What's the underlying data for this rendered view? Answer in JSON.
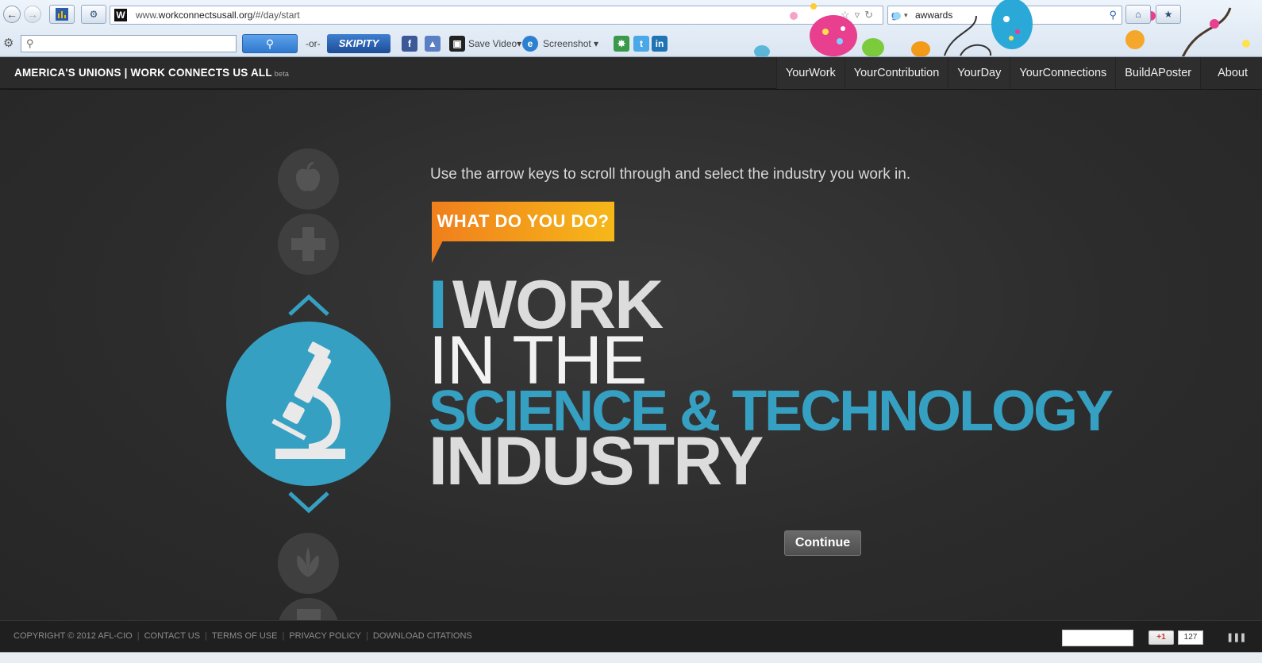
{
  "browser": {
    "url_prefix": "www.",
    "url_host": "workconnectsusall.org",
    "url_path": "/#/day/start",
    "search_query": "awwards",
    "toolbar": {
      "or_label": "-or-",
      "skipity_label": "SKIPITY",
      "save_video_label": "Save Video",
      "screenshot_label": "Screenshot"
    }
  },
  "site": {
    "brand": "AMERICA'S UNIONS | WORK CONNECTS US ALL",
    "beta": "beta",
    "nav": [
      "YourWork",
      "YourContribution",
      "YourDay",
      "YourConnections",
      "BuildAPoster",
      "About"
    ]
  },
  "main": {
    "instructions": "Use the arrow keys to scroll through and select the industry you work in.",
    "badge": "WHAT DO YOU DO?",
    "headline_i": "I",
    "headline_work": "WORK",
    "headline_inthe": "IN THE",
    "headline_industry_name": "SCIENCE & TECHNOLOGY",
    "headline_industry": "INDUSTRY",
    "continue_label": "Continue",
    "industries": [
      "apple-icon",
      "medical-cross-icon",
      "microscope-icon",
      "leaf-icon",
      "document-icon"
    ],
    "selected_industry_icon": "microscope-icon",
    "accent_color": "#36a0c2",
    "badge_colors": [
      "#f07f1c",
      "#f6b819"
    ]
  },
  "footer": {
    "links": [
      "COPYRIGHT © 2012 AFL-CIO",
      "CONTACT US",
      "TERMS OF USE",
      "PRIVACY POLICY",
      "DOWNLOAD CITATIONS"
    ],
    "gplus_label": "+1",
    "gplus_count": "127"
  }
}
